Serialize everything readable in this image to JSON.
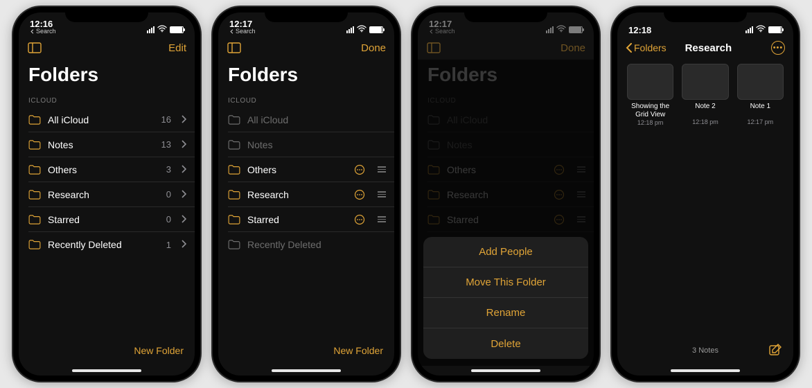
{
  "accent": "#e0a437",
  "screens": [
    {
      "time": "12:16",
      "back_search": "Search",
      "nav": {
        "left_icon": "columns-icon",
        "right": "Edit",
        "title": ""
      },
      "big_title": "Folders",
      "section": "ICLOUD",
      "rows": [
        {
          "label": "All iCloud",
          "count": "16",
          "chevron": true
        },
        {
          "label": "Notes",
          "count": "13",
          "chevron": true
        },
        {
          "label": "Others",
          "count": "3",
          "chevron": true
        },
        {
          "label": "Research",
          "count": "0",
          "chevron": true
        },
        {
          "label": "Starred",
          "count": "0",
          "chevron": true
        },
        {
          "label": "Recently Deleted",
          "count": "1",
          "chevron": true
        }
      ],
      "bottom": {
        "right": "New Folder"
      }
    },
    {
      "time": "12:17",
      "back_search": "Search",
      "nav": {
        "left_icon": "columns-icon",
        "right": "Done",
        "title": ""
      },
      "big_title": "Folders",
      "section": "ICLOUD",
      "rows": [
        {
          "label": "All iCloud",
          "dim": true
        },
        {
          "label": "Notes",
          "dim": true
        },
        {
          "label": "Others",
          "more": true,
          "drag": true
        },
        {
          "label": "Research",
          "more": true,
          "drag": true
        },
        {
          "label": "Starred",
          "more": true,
          "drag": true
        },
        {
          "label": "Recently Deleted",
          "dim": true
        }
      ],
      "bottom": {
        "right": "New Folder"
      }
    },
    {
      "time": "12:17",
      "back_search": "Search",
      "nav": {
        "left_icon": "columns-icon",
        "right": "Done",
        "title": ""
      },
      "big_title": "Folders",
      "section": "ICLOUD",
      "rows": [
        {
          "label": "All iCloud",
          "dim": true
        },
        {
          "label": "Notes",
          "dim": true
        },
        {
          "label": "Others",
          "more": true,
          "drag": true
        },
        {
          "label": "Research",
          "more": true,
          "drag": true
        },
        {
          "label": "Starred",
          "more": true,
          "drag": true
        },
        {
          "label": "Recently Deleted",
          "dim": true
        }
      ],
      "sheet": [
        "Add People",
        "Move This Folder",
        "Rename",
        "Delete"
      ]
    },
    {
      "time": "12:18",
      "nav": {
        "back": "Folders",
        "title": "Research",
        "right_icon": "ellipsis-circle"
      },
      "grid": [
        {
          "title": "Showing the Grid View",
          "time": "12:18 pm"
        },
        {
          "title": "Note 2",
          "time": "12:18 pm"
        },
        {
          "title": "Note 1",
          "time": "12:17 pm"
        }
      ],
      "bottom_center": "3 Notes",
      "compose": true
    }
  ]
}
